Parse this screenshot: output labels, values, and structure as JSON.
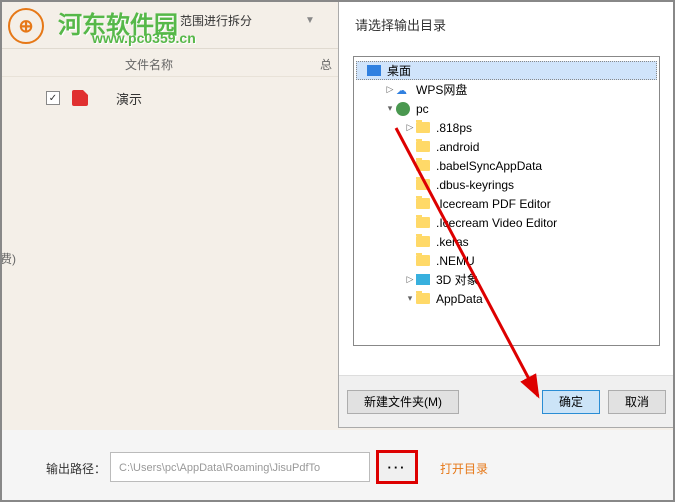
{
  "brand": {
    "name": "河东软件园",
    "url": "www.pc0359.cn"
  },
  "range_text": "范围进行拆分",
  "columns": {
    "filename": "文件名称",
    "total": "总"
  },
  "file": {
    "name": "演示",
    "checked": true
  },
  "fee_label": "费)",
  "output": {
    "label": "输出路径：",
    "path": "C:\\Users\\pc\\AppData\\Roaming\\JisuPdfTo",
    "browse": "···",
    "open_dir": "打开目录"
  },
  "dialog": {
    "title": "请选择输出目录",
    "tree": {
      "desktop": "桌面",
      "wps": "WPS网盘",
      "pc": "pc",
      "items": [
        ".818ps",
        ".android",
        ".babelSyncAppData",
        ".dbus-keyrings",
        ".Icecream PDF Editor",
        ".Icecream Video Editor",
        ".keras",
        ".NEMU"
      ],
      "threed": "3D 对象",
      "appdata": "AppData"
    },
    "buttons": {
      "new_folder": "新建文件夹(M)",
      "ok": "确定",
      "cancel": "取消"
    }
  }
}
